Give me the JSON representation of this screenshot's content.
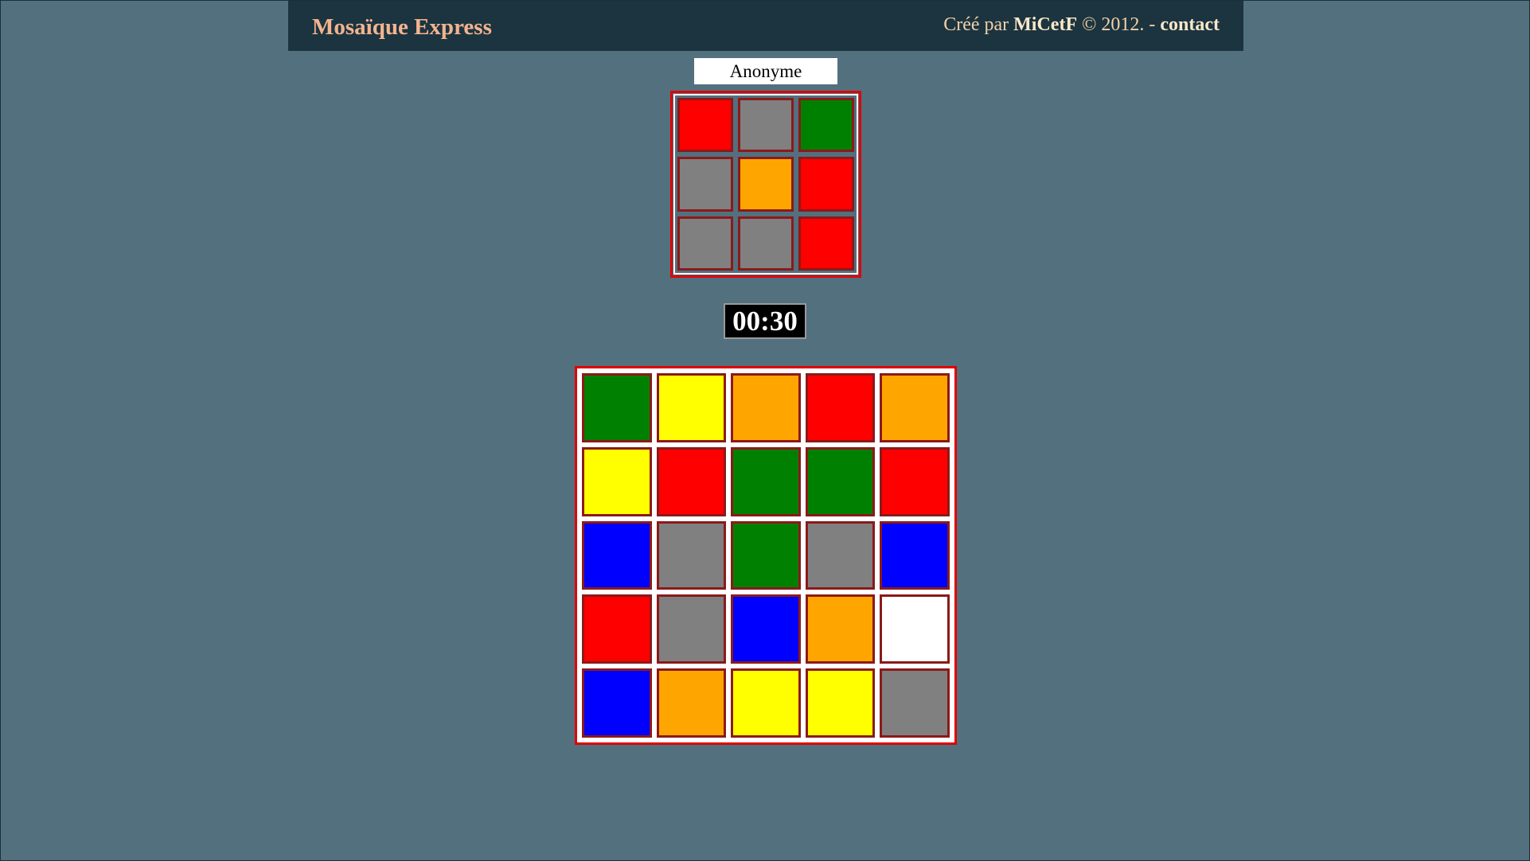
{
  "header": {
    "title": "Mosaïque Express",
    "credit_prefix": "Créé par ",
    "author": "MiCetF",
    "credit_suffix": " © 2012. - ",
    "contact_label": "contact"
  },
  "player": {
    "name": "Anonyme"
  },
  "timer": {
    "value": "00:30"
  },
  "palette": {
    "red": "#ff0000",
    "grey": "#808080",
    "green": "#008000",
    "orange": "#ffa500",
    "yellow": "#ffff00",
    "blue": "#0000ff",
    "white": "#ffffff"
  },
  "target_pattern": [
    [
      "red",
      "grey",
      "green"
    ],
    [
      "grey",
      "orange",
      "red"
    ],
    [
      "grey",
      "grey",
      "red"
    ]
  ],
  "board": [
    [
      "green",
      "yellow",
      "orange",
      "red",
      "orange"
    ],
    [
      "yellow",
      "red",
      "green",
      "green",
      "red"
    ],
    [
      "blue",
      "grey",
      "green",
      "grey",
      "blue"
    ],
    [
      "red",
      "grey",
      "blue",
      "orange",
      "white"
    ],
    [
      "blue",
      "orange",
      "yellow",
      "yellow",
      "grey"
    ]
  ]
}
